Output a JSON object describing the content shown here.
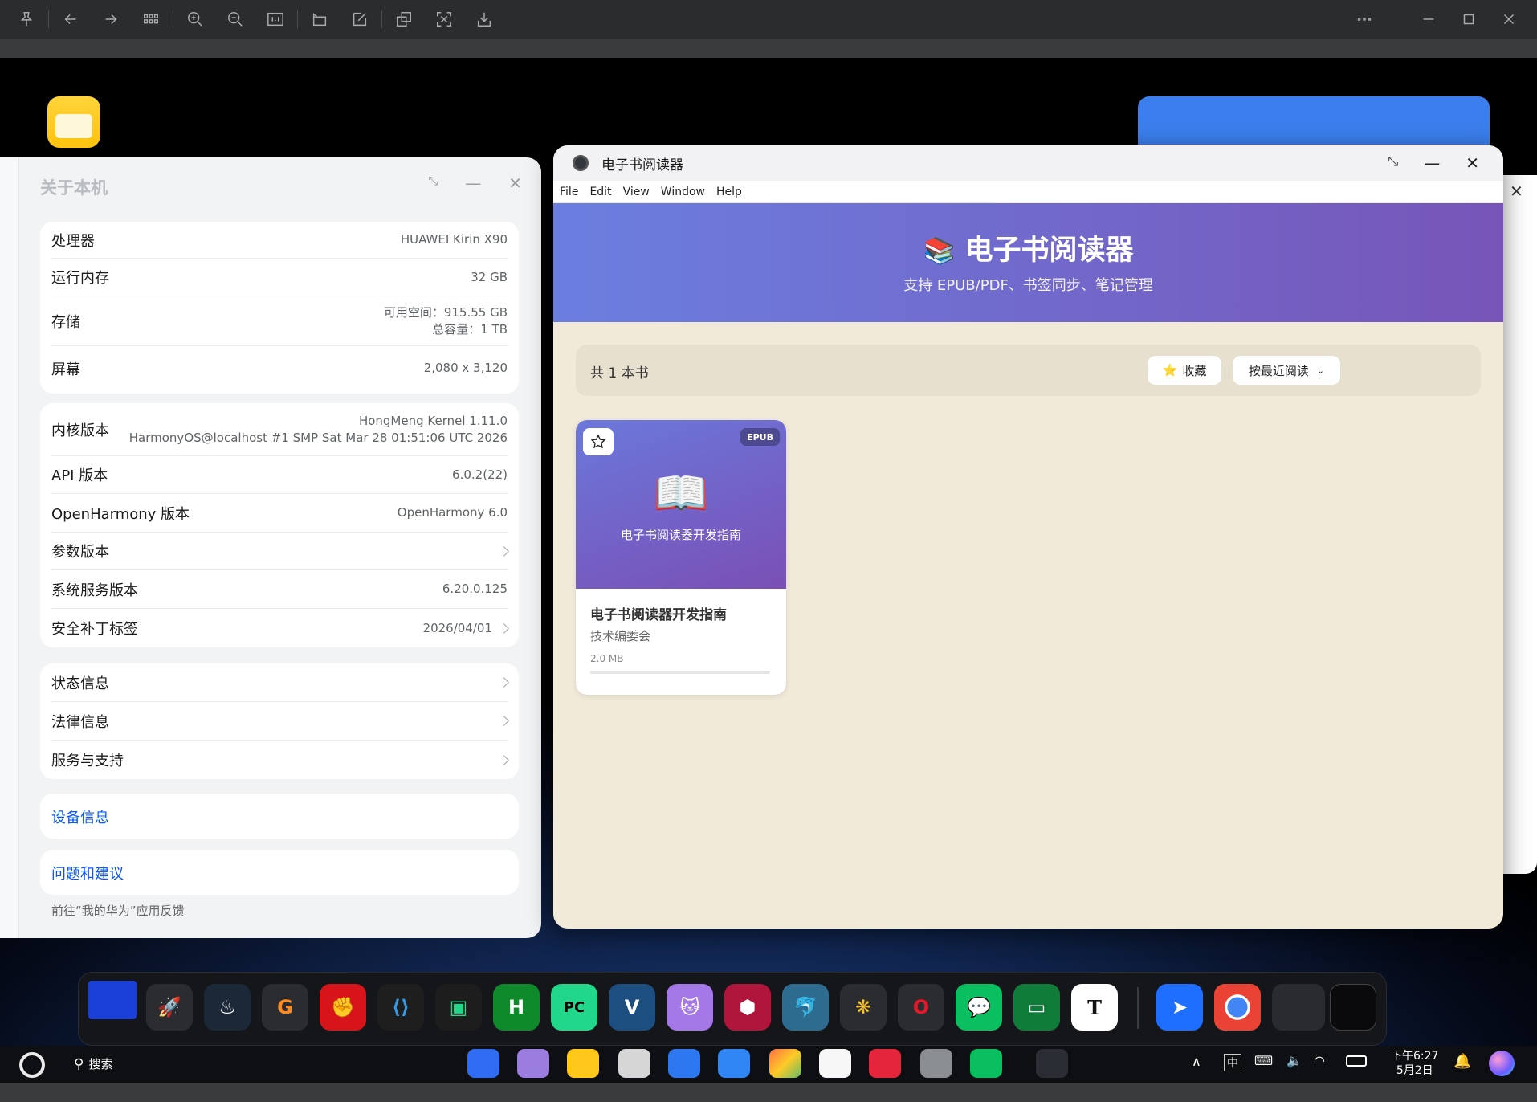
{
  "about": {
    "title": "关于本机",
    "rows_hw": [
      {
        "label": "处理器",
        "value": "HUAWEI Kirin X90"
      },
      {
        "label": "运行内存",
        "value": "32 GB"
      },
      {
        "label": "存储",
        "value": "可用空间：915.55 GB",
        "value2": "总容量：1 TB"
      },
      {
        "label": "屏幕",
        "value": "2,080 x 3,120"
      }
    ],
    "rows_sw": [
      {
        "label": "内核版本",
        "value": "HongMeng Kernel 1.11.0",
        "value2": "HarmonyOS@localhost #1 SMP Sat Mar 28 01:51:06 UTC 2026"
      },
      {
        "label": "API 版本",
        "value": "6.0.2(22)"
      },
      {
        "label": "OpenHarmony 版本",
        "value": "OpenHarmony 6.0"
      },
      {
        "label": "参数版本",
        "value": ""
      },
      {
        "label": "系统服务版本",
        "value": "6.20.0.125"
      },
      {
        "label": "安全补丁标签",
        "value": "2026/04/01"
      }
    ],
    "rows_info": [
      {
        "label": "状态信息"
      },
      {
        "label": "法律信息"
      },
      {
        "label": "服务与支持"
      }
    ],
    "device_info": "设备信息",
    "feedback": "问题和建议",
    "feedback_hint": "前往“我的华为”应用反馈"
  },
  "ebook": {
    "window_title": "电子书阅读器",
    "menu": [
      "File",
      "Edit",
      "View",
      "Window",
      "Help"
    ],
    "header_title": "电子书阅读器",
    "header_subtitle": "支持 EPUB/PDF、书签同步、笔记管理",
    "book_count": "共 1 本书",
    "favorites_label": "收藏",
    "sort_label": "按最近阅读",
    "book": {
      "format": "EPUB",
      "cover_title": "电子书阅读器开发指南",
      "title": "电子书阅读器开发指南",
      "author": "技术编委会",
      "size": "2.0 MB",
      "progress": 0.0
    }
  },
  "taskbar": {
    "search_label": "搜索",
    "ime_label": "中",
    "time": "下午6:27",
    "date": "5月2日"
  },
  "colors": {
    "accent": "#0a59f7",
    "header_start": "#6b7fe0",
    "header_end": "#7755b8",
    "reader_bg": "#f2ead9"
  }
}
